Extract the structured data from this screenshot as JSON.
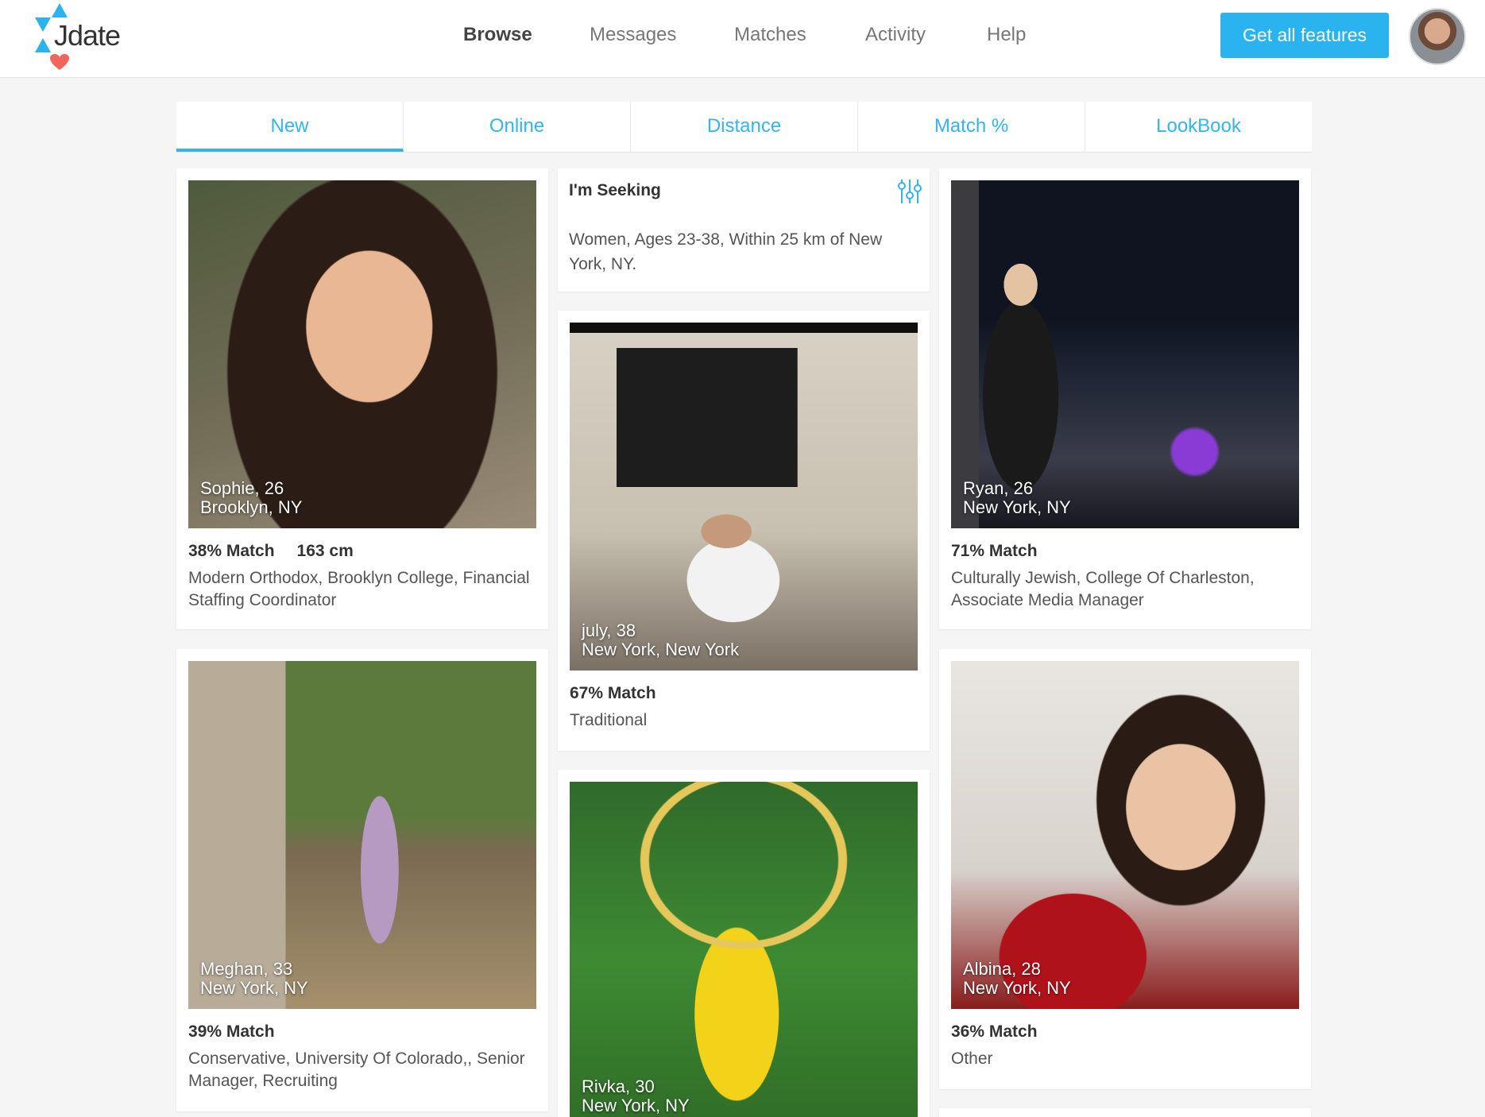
{
  "header": {
    "logo_text": "Jdate",
    "nav": [
      "Browse",
      "Messages",
      "Matches",
      "Activity",
      "Help"
    ],
    "active_nav": "Browse",
    "cta_label": "Get all features"
  },
  "tabs": [
    "New",
    "Online",
    "Distance",
    "Match %",
    "LookBook"
  ],
  "active_tab": "New",
  "seeking": {
    "title": "I'm Seeking",
    "text": "Women, Ages 23-38, Within 25 km of New York, NY."
  },
  "profiles": [
    {
      "name_age": "Sophie, 26",
      "location": "Brooklyn, NY",
      "match": "38% Match",
      "height": "163 cm",
      "desc": "Modern Orthodox, Brooklyn College, Financial Staffing Coordinator"
    },
    {
      "name_age": "july, 38",
      "location": "New York, New York",
      "match": "67% Match",
      "desc": "Traditional"
    },
    {
      "name_age": "Ryan, 26",
      "location": "New York, NY",
      "match": "71% Match",
      "desc": "Culturally Jewish, College Of Charleston, Associate Media Manager"
    },
    {
      "name_age": "Meghan, 33",
      "location": "New York, NY",
      "match": "39% Match",
      "desc": "Conservative, University Of Colorado,, Senior Manager, Recruiting"
    },
    {
      "name_age": "Rivka, 30",
      "location": "New York, NY"
    },
    {
      "name_age": "Albina, 28",
      "location": "New York, NY",
      "match": "36% Match",
      "desc": "Other"
    }
  ],
  "colors": {
    "accent": "#2bb3f0",
    "tab_text": "#35b4ec",
    "logo_blue": "#2bb3f0",
    "logo_heart": "#f2655b"
  }
}
